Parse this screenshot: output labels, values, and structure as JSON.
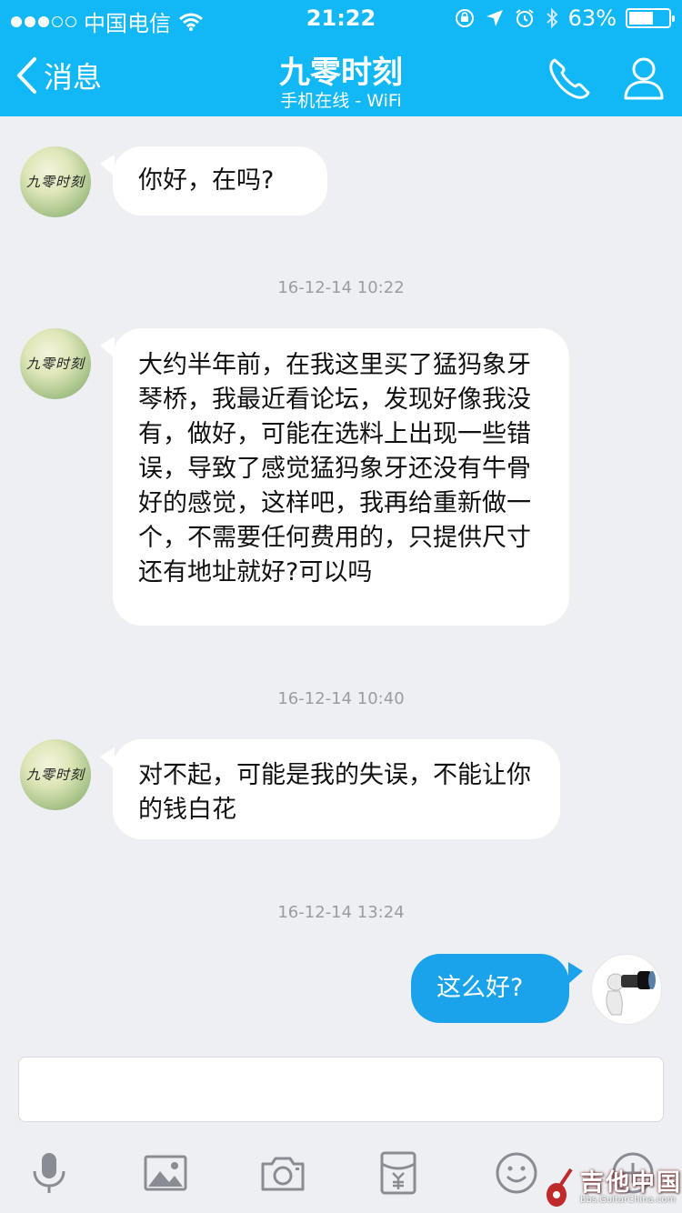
{
  "status_bar": {
    "carrier": "中国电信",
    "time": "21:22",
    "battery": "63%",
    "battery_level": 0.63,
    "signal_bars_filled": 3,
    "signal_bars_total": 5
  },
  "nav": {
    "back_label": "消息",
    "title": "九零时刻",
    "subtitle": "手机在线 - WiFi"
  },
  "contact_avatar_text": "九零时刻",
  "messages": [
    {
      "direction": "in",
      "text": "你好，在吗?"
    },
    {
      "direction": "in",
      "text": "大约半年前，在我这里买了猛犸象牙琴桥，我最近看论坛，发现好像我没有，做好，可能在选料上出现一些错误，导致了感觉猛犸象牙还没有牛骨好的感觉，这样吧，我再给重新做一个，不需要任何费用的，只提供尺寸还有地址就好?可以吗"
    },
    {
      "direction": "in",
      "text": "对不起，可能是我的失误，不能让你的钱白花"
    },
    {
      "direction": "out",
      "text": "这么好?"
    }
  ],
  "timestamps": [
    "16-12-14 10:22",
    "16-12-14 10:40",
    "16-12-14 13:24"
  ],
  "input": {
    "value": "",
    "placeholder": ""
  },
  "toolbar_icons": [
    "microphone-icon",
    "image-icon",
    "camera-icon",
    "red-packet-icon",
    "emoji-icon",
    "plus-icon"
  ],
  "watermark": {
    "title": "吉他中国",
    "url": "bbs.GuitarChina.com"
  },
  "colors": {
    "header": "#12b7f5",
    "outgoing_bubble": "#1aa3ea",
    "background": "#eeeff3",
    "icon_gray": "#8a8c94"
  }
}
